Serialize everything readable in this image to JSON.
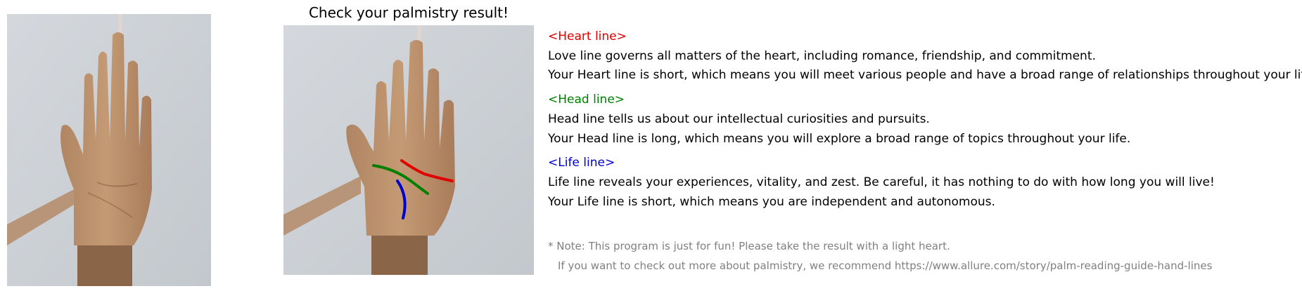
{
  "title": "Check your palmistry result!",
  "colors": {
    "heart": "#e00000",
    "head": "#008000",
    "life": "#0000d0",
    "note": "#808080"
  },
  "heart": {
    "heading": "<Heart line>",
    "desc": "Love line governs all matters of the heart, including romance, friendship, and commitment.",
    "result": "Your Heart line is short, which means you will meet various people and have a broad range of relationships throughout your life."
  },
  "head": {
    "heading": "<Head line>",
    "desc": "Head line tells us about our intellectual curiosities and pursuits.",
    "result": "Your Head line is long, which means you will explore a broad range of topics throughout your life."
  },
  "life": {
    "heading": "<Life line>",
    "desc": "Life line reveals your experiences, vitality, and zest. Be careful, it has nothing to do with how long you will live!",
    "result": "Your Life line is short, which means you are independent and autonomous."
  },
  "note": {
    "line1": "* Note: This program is just for fun! Please take the result with a light heart.",
    "line2": "If you want to check out more about palmistry, we recommend https://www.allure.com/story/palm-reading-guide-hand-lines"
  }
}
